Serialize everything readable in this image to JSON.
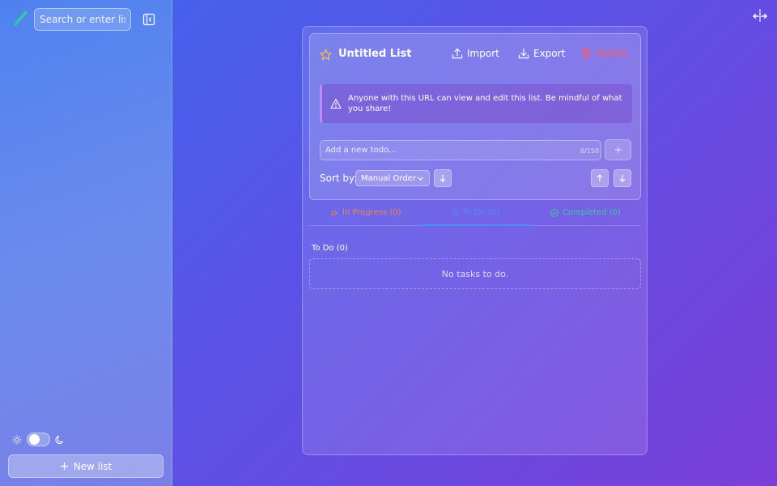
{
  "sidebar": {
    "search_placeholder": "Search or enter list",
    "new_list_label": "New list",
    "theme": {
      "mode": "light"
    }
  },
  "list": {
    "title": "Untitled List",
    "starred": false,
    "actions": {
      "import_label": "Import",
      "export_label": "Export",
      "delete_label": "Delete"
    },
    "warning": "Anyone with this URL can view and edit this list. Be mindful of what you share!",
    "input_placeholder": "Add a new todo...",
    "char_counter": "0/150",
    "sort": {
      "label": "Sort by:",
      "selected": "Manual Order"
    },
    "tabs": [
      {
        "label": "In Progress (0)",
        "color": "#f0834a",
        "icon": "double-chevron-right-icon"
      },
      {
        "label": "To Do (0)",
        "color": "#4d8df7",
        "icon": "list-icon",
        "active": true
      },
      {
        "label": "Completed (0)",
        "color": "#3cc9a0",
        "icon": "check-circle-icon"
      }
    ],
    "section_label": "To Do (0)",
    "empty_message": "No tasks to do."
  },
  "colors": {
    "accent": "#4d8df7",
    "delete": "#ff5a6a",
    "star": "#f5c542"
  }
}
